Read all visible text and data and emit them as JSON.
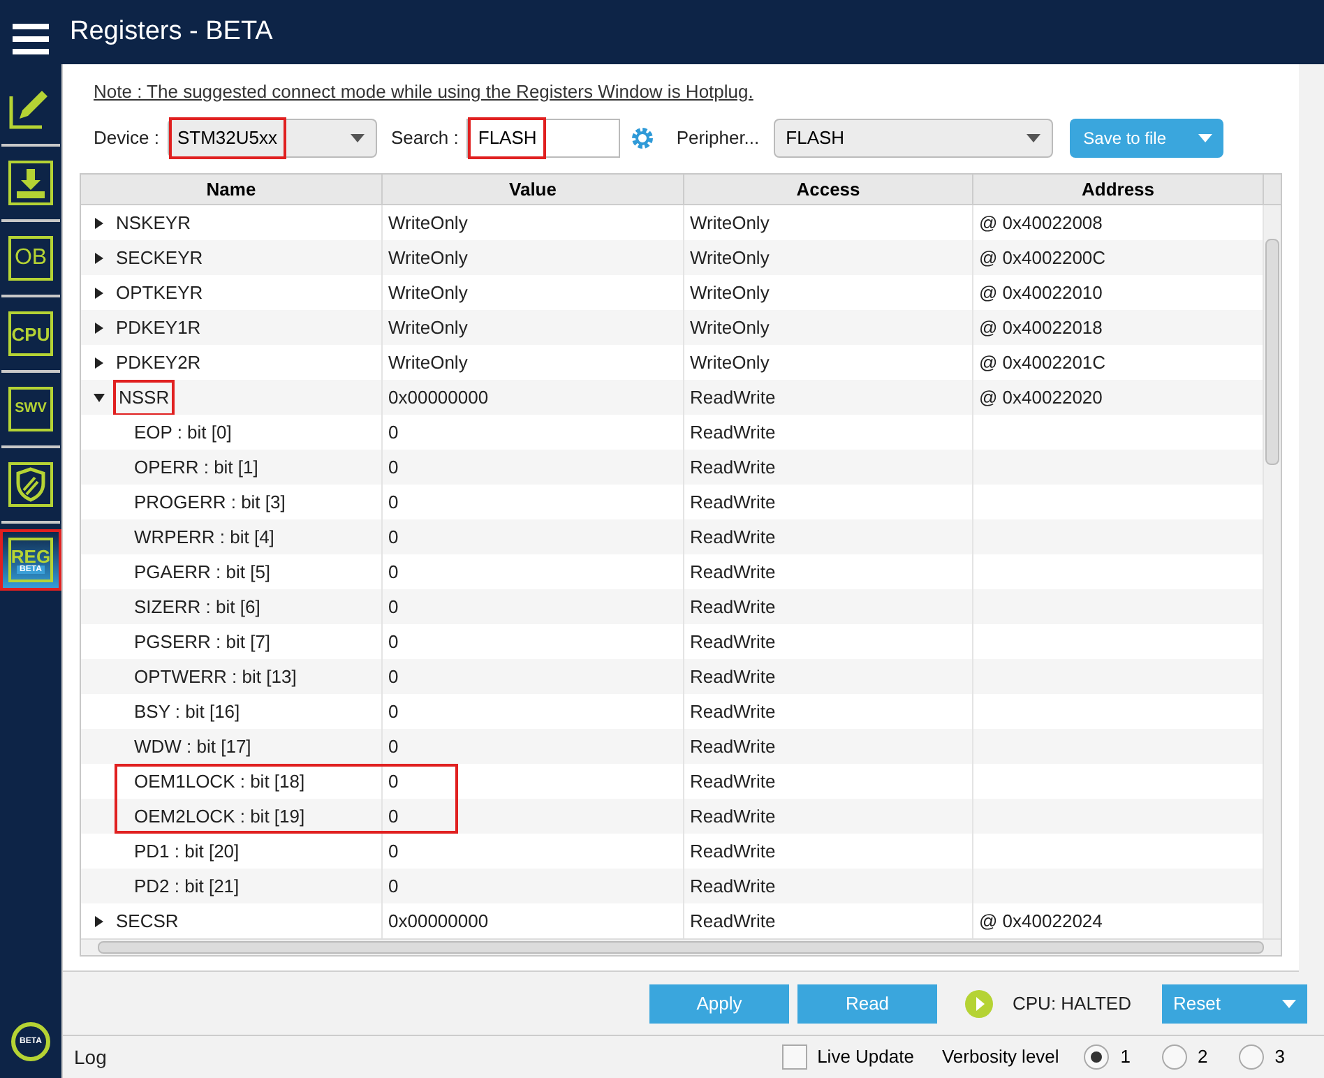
{
  "window": {
    "title": "Registers - BETA"
  },
  "sidebar": {
    "items": [
      {
        "kind": "edit",
        "selected": false
      },
      {
        "kind": "download",
        "selected": false
      },
      {
        "kind": "ob",
        "label": "OB",
        "selected": false
      },
      {
        "kind": "cpu",
        "label": "CPU",
        "selected": false
      },
      {
        "kind": "swv",
        "label": "SWV",
        "selected": false
      },
      {
        "kind": "shield",
        "selected": false
      },
      {
        "kind": "reg",
        "label": "REG",
        "sublabel": "BETA",
        "selected": true,
        "highlighted": true
      }
    ],
    "bottom_label": "BETA"
  },
  "note": "Note : The suggested connect mode while using the Registers Window is Hotplug.",
  "toolbar": {
    "device_label": "Device :",
    "device": "STM32U5xx",
    "device_highlighted": true,
    "search_label": "Search :",
    "search": "FLASH",
    "search_highlighted": true,
    "peripheral_label": "Peripher...",
    "peripheral": "FLASH",
    "save_button": "Save to file"
  },
  "table": {
    "columns": [
      "Name",
      "Value",
      "Access",
      "Address"
    ],
    "rows": [
      {
        "name": "NSKEYR",
        "value": "WriteOnly",
        "access": "WriteOnly",
        "address": "@ 0x40022008",
        "expanded": false
      },
      {
        "name": "SECKEYR",
        "value": "WriteOnly",
        "access": "WriteOnly",
        "address": "@ 0x4002200C",
        "expanded": false
      },
      {
        "name": "OPTKEYR",
        "value": "WriteOnly",
        "access": "WriteOnly",
        "address": "@ 0x40022010",
        "expanded": false
      },
      {
        "name": "PDKEY1R",
        "value": "WriteOnly",
        "access": "WriteOnly",
        "address": "@ 0x40022018",
        "expanded": false
      },
      {
        "name": "PDKEY2R",
        "value": "WriteOnly",
        "access": "WriteOnly",
        "address": "@ 0x4002201C",
        "expanded": false
      },
      {
        "name": "NSSR",
        "value": "0x00000000",
        "access": "ReadWrite",
        "address": "@ 0x40022020",
        "expanded": true,
        "highlighted": true,
        "children": [
          {
            "name": "EOP : bit [0]",
            "value": "0",
            "access": "ReadWrite",
            "highlighted": false
          },
          {
            "name": "OPERR : bit [1]",
            "value": "0",
            "access": "ReadWrite",
            "highlighted": false
          },
          {
            "name": "PROGERR : bit [3]",
            "value": "0",
            "access": "ReadWrite",
            "highlighted": false
          },
          {
            "name": "WRPERR : bit [4]",
            "value": "0",
            "access": "ReadWrite",
            "highlighted": false
          },
          {
            "name": "PGAERR : bit [5]",
            "value": "0",
            "access": "ReadWrite",
            "highlighted": false
          },
          {
            "name": "SIZERR : bit [6]",
            "value": "0",
            "access": "ReadWrite",
            "highlighted": false
          },
          {
            "name": "PGSERR : bit [7]",
            "value": "0",
            "access": "ReadWrite",
            "highlighted": false
          },
          {
            "name": "OPTWERR : bit [13]",
            "value": "0",
            "access": "ReadWrite",
            "highlighted": false
          },
          {
            "name": "BSY : bit [16]",
            "value": "0",
            "access": "ReadWrite",
            "highlighted": false
          },
          {
            "name": "WDW : bit [17]",
            "value": "0",
            "access": "ReadWrite",
            "highlighted": false
          },
          {
            "name": "OEM1LOCK : bit [18]",
            "value": "0",
            "access": "ReadWrite",
            "highlighted": true
          },
          {
            "name": "OEM2LOCK : bit [19]",
            "value": "0",
            "access": "ReadWrite",
            "highlighted": true
          },
          {
            "name": "PD1 : bit [20]",
            "value": "0",
            "access": "ReadWrite",
            "highlighted": false
          },
          {
            "name": "PD2 : bit [21]",
            "value": "0",
            "access": "ReadWrite",
            "highlighted": false
          }
        ]
      },
      {
        "name": "SECSR",
        "value": "0x00000000",
        "access": "ReadWrite",
        "address": "@ 0x40022024",
        "expanded": false
      }
    ]
  },
  "actions": {
    "apply": "Apply",
    "read": "Read",
    "cpu_status": "CPU: HALTED",
    "reset": "Reset"
  },
  "log_bar": {
    "title": "Log",
    "live_update": {
      "label": "Live Update",
      "checked": false
    },
    "verbosity_label": "Verbosity level",
    "levels": [
      {
        "label": "1",
        "selected": true
      },
      {
        "label": "2",
        "selected": false
      },
      {
        "label": "3",
        "selected": false
      }
    ]
  }
}
